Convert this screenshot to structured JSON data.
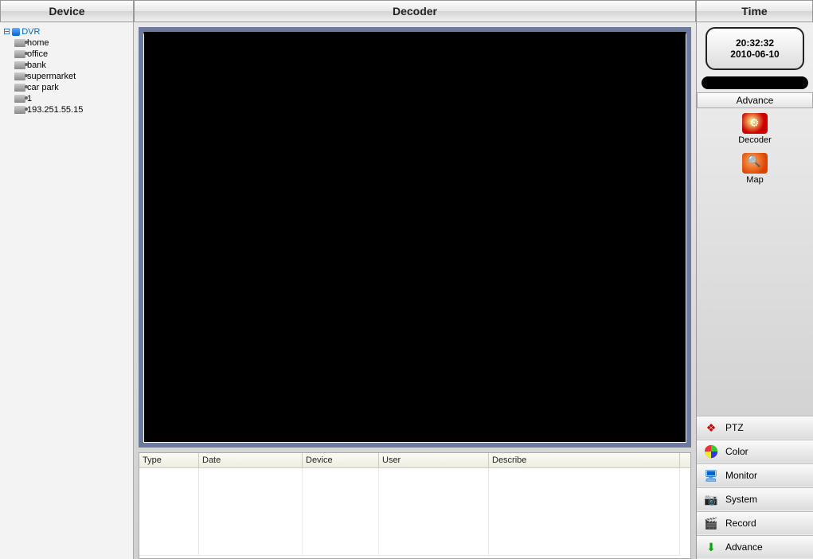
{
  "headers": {
    "device": "Device",
    "decoder": "Decoder",
    "time": "Time"
  },
  "tree": {
    "root": "DVR",
    "items": [
      "home",
      "office",
      "bank",
      "supermarket",
      "car park",
      "1",
      "193.251.55.15"
    ]
  },
  "clock": {
    "time": "20:32:32",
    "date": "2010-06-10"
  },
  "advance": {
    "title": "Advance",
    "tools": {
      "decoder": "Decoder",
      "map": "Map"
    }
  },
  "log": {
    "cols": {
      "type": "Type",
      "date": "Date",
      "device": "Device",
      "user": "User",
      "describe": "Describe"
    }
  },
  "sidebuttons": {
    "ptz": "PTZ",
    "color": "Color",
    "monitor": "Monitor",
    "system": "System",
    "record": "Record",
    "advance": "Advance"
  }
}
